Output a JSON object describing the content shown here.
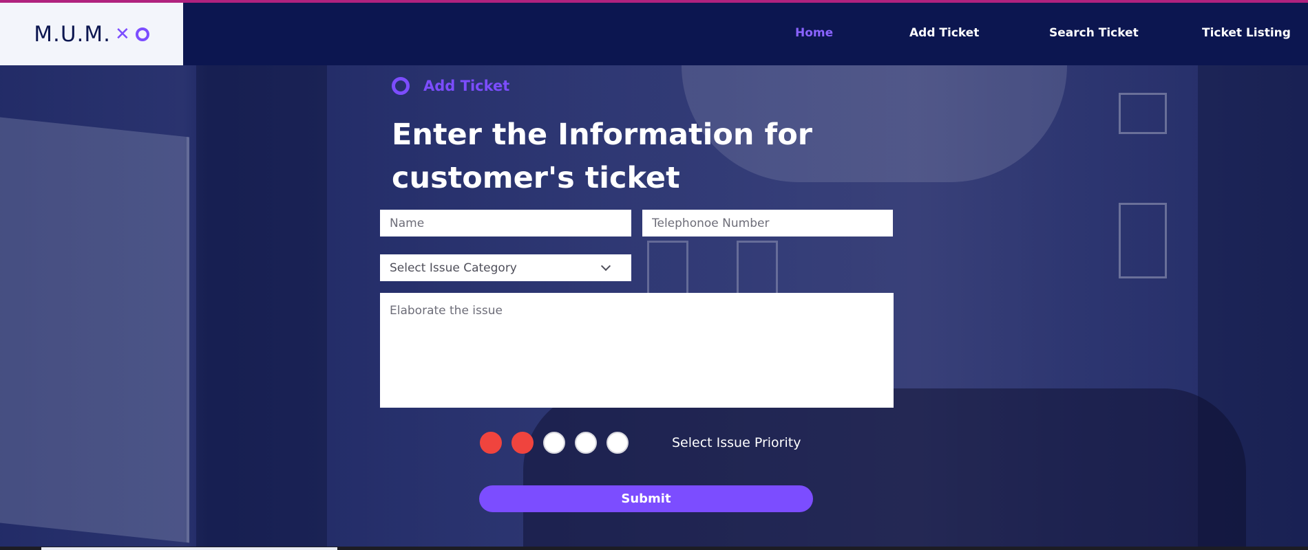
{
  "brand": {
    "logo_text": "M.U.M.",
    "logo_mark": "x-o-mark"
  },
  "nav": {
    "items": [
      {
        "label": "Home",
        "active": true
      },
      {
        "label": "Add Ticket",
        "active": false
      },
      {
        "label": "Search Ticket",
        "active": false
      },
      {
        "label": "Ticket Listing",
        "active": false
      }
    ]
  },
  "form": {
    "section_label": "Add Ticket",
    "title": "Enter the Information for customer's ticket",
    "name_placeholder": "Name",
    "phone_placeholder": "Telephonoe Number",
    "category_selected": "Select Issue Category",
    "issue_placeholder": "Elaborate the issue",
    "priority": {
      "label": "Select Issue Priority",
      "selected": 2,
      "max": 5
    },
    "submit_label": "Submit"
  },
  "colors": {
    "navy": "#0c1650",
    "accent": "#7c4dff",
    "priority_on": "#f0443e",
    "top_line": "#b0227e"
  }
}
